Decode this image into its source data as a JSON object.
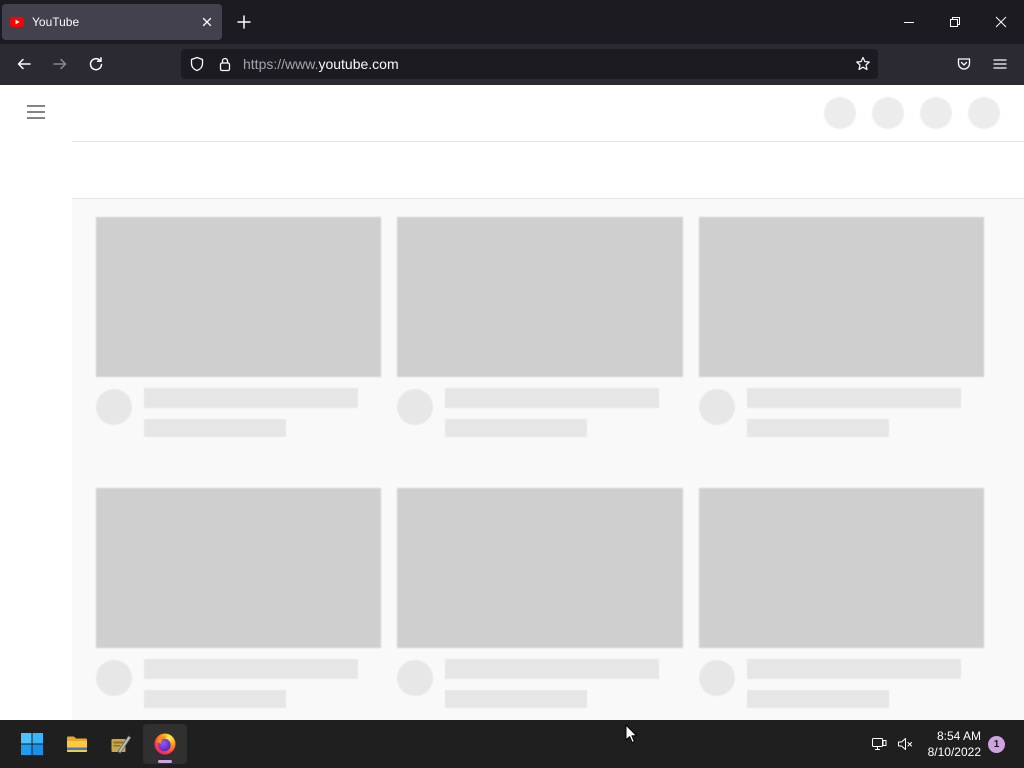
{
  "browser": {
    "tab": {
      "title": "YouTube",
      "favicon": "youtube-icon",
      "close_icon": "close-icon"
    },
    "new_tab_icon": "plus-icon",
    "window_controls": [
      "minimize-icon",
      "restore-icon",
      "close-icon"
    ],
    "toolbar": {
      "back_icon": "arrow-left-icon",
      "forward_icon": "arrow-right-icon",
      "forward_enabled": false,
      "reload_icon": "reload-icon",
      "address_bar": {
        "tracking_protection_icon": "shield-icon",
        "connection_icon": "lock-icon",
        "url_prefix": "https://www.",
        "url_domain": "youtube.com",
        "bookmark_icon": "star-icon"
      },
      "pocket_icon": "pocket-icon",
      "menu_icon": "hamburger-menu-icon"
    }
  },
  "page": {
    "guide_button_icon": "hamburger-menu-icon"
  },
  "taskbar": {
    "apps": [
      {
        "icon": "windows-start-icon",
        "active": false
      },
      {
        "icon": "file-explorer-icon",
        "active": false
      },
      {
        "icon": "pen-tool-app-icon",
        "active": false
      },
      {
        "icon": "firefox-icon",
        "active": true
      }
    ],
    "tray": {
      "network_icon": "ethernet-network-icon",
      "volume_icon": "speaker-muted-icon",
      "time": "8:54 AM",
      "date": "8/10/2022",
      "notification_count": "1"
    }
  },
  "colors": {
    "youtube_red": "#ff0000",
    "windows_accent": "#cfa3e0",
    "windows_logo_blue": "#1f9cf0"
  }
}
